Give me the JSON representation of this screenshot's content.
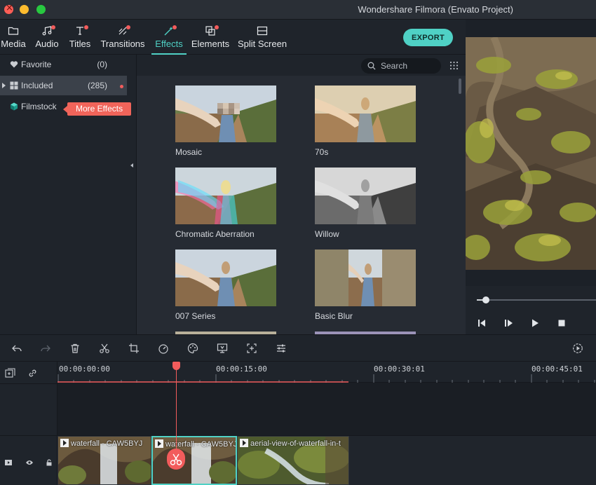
{
  "window": {
    "title": "Wondershare Filmora (Envato Project)"
  },
  "tabs": [
    {
      "label": "Media",
      "icon": "folder-icon",
      "dot": false
    },
    {
      "label": "Audio",
      "icon": "music-note-icon",
      "dot": true
    },
    {
      "label": "Titles",
      "icon": "text-t-icon",
      "dot": true
    },
    {
      "label": "Transitions",
      "icon": "transitions-icon",
      "dot": true
    },
    {
      "label": "Effects",
      "icon": "effects-wand-icon",
      "dot": true,
      "active": true
    },
    {
      "label": "Elements",
      "icon": "elements-icon",
      "dot": true
    },
    {
      "label": "Split Screen",
      "icon": "split-screen-icon",
      "dot": false
    }
  ],
  "export_label": "EXPORT",
  "sidebar": {
    "items": [
      {
        "label": "Favorite",
        "count": "(0)",
        "icon": "heart-icon"
      },
      {
        "label": "Included",
        "count": "(285)",
        "icon": "grid-icon",
        "selected": true
      },
      {
        "label": "Filmstock",
        "count": "",
        "icon": "filmstock-cube-icon"
      }
    ],
    "more_effects": "More Effects"
  },
  "search": {
    "placeholder": "Search"
  },
  "effects": [
    {
      "label": "Mosaic"
    },
    {
      "label": "70s"
    },
    {
      "label": "Chromatic Aberration"
    },
    {
      "label": "Willow"
    },
    {
      "label": "007 Series"
    },
    {
      "label": "Basic Blur"
    }
  ],
  "timeline": {
    "timecodes": [
      "00:00:00:00",
      "00:00:15:00",
      "00:00:30:01",
      "00:00:45:01"
    ],
    "clips": [
      {
        "name": "waterfall - CAW5BYJ"
      },
      {
        "name": "waterfall - CAW5BYJ",
        "selected": true
      },
      {
        "name": "aerial-view-of-waterfall-in-t"
      }
    ]
  },
  "colors": {
    "accent": "#4fd1c5",
    "alert": "#f25c5c",
    "background": "#1c2128"
  }
}
